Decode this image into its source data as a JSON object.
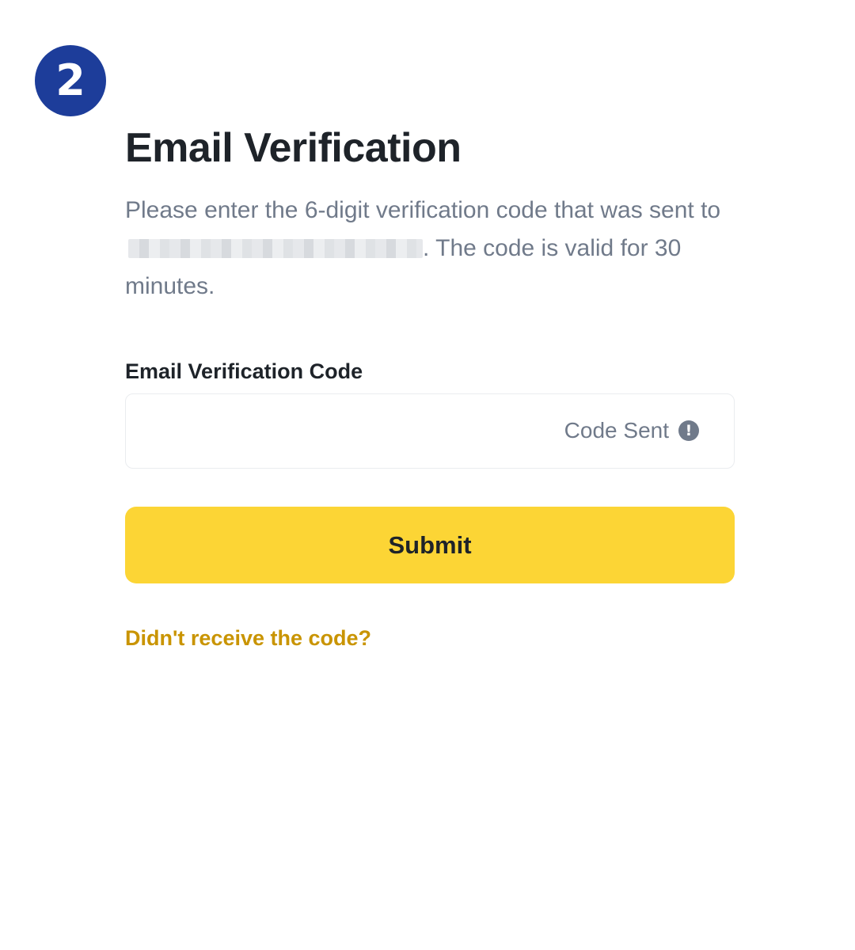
{
  "step": {
    "number": "2"
  },
  "page": {
    "title": "Email Verification",
    "description_before": "Please enter the 6-digit verification code that was sent to",
    "description_after": ". The code is valid for 30 minutes."
  },
  "form": {
    "code_label": "Email Verification Code",
    "code_value": "",
    "code_status": "Code Sent",
    "status_icon": "exclamation-circle-icon",
    "submit_label": "Submit",
    "resend_link": "Didn't receive the code?"
  },
  "colors": {
    "badge": "#1d3d9a",
    "primary_button": "#fcd535",
    "link": "#c99400",
    "muted_text": "#707a8a",
    "heading_text": "#1e2329"
  }
}
